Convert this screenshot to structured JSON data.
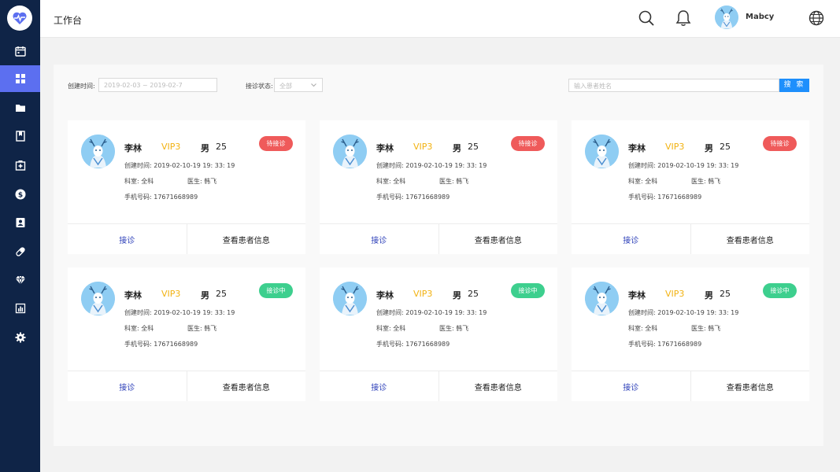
{
  "header": {
    "page_title": "工作台",
    "user_name": "Mabcy",
    "icons": [
      "search-icon",
      "bell-icon",
      "globe-icon"
    ]
  },
  "sidebar": {
    "logo_icon": "heartbeat-icon",
    "items": [
      {
        "icon": "calendar-icon"
      },
      {
        "icon": "dashboard-icon",
        "active": true
      },
      {
        "icon": "folder-icon"
      },
      {
        "icon": "bookmark-icon"
      },
      {
        "icon": "medical-box-icon"
      },
      {
        "icon": "dollar-icon"
      },
      {
        "icon": "contact-card-icon"
      },
      {
        "icon": "pill-icon"
      },
      {
        "icon": "diamond-icon"
      },
      {
        "icon": "bar-chart-icon"
      },
      {
        "icon": "settings-icon"
      }
    ]
  },
  "filters": {
    "created_label": "创建时间:",
    "created_value": "2019-02-03 ~ 2019-02-7",
    "status_label": "接诊状态:",
    "status_value": "全部",
    "search_placeholder": "输入患者姓名",
    "search_button": "搜 索"
  },
  "cards": [
    {
      "name": "李林",
      "vip": "VIP3",
      "gender": "男",
      "age": "25",
      "status": "待接诊",
      "status_type": "waiting",
      "created": "创建时间: 2019-02-10-19 19: 33: 19",
      "dept": "科室: 全科",
      "doctor": "医生: 韩飞",
      "phone": "手机号码: 17671668989",
      "action_receive": "接诊",
      "action_view": "查看患者信息"
    },
    {
      "name": "李林",
      "vip": "VIP3",
      "gender": "男",
      "age": "25",
      "status": "待接诊",
      "status_type": "waiting",
      "created": "创建时间: 2019-02-10-19 19: 33: 19",
      "dept": "科室: 全科",
      "doctor": "医生: 韩飞",
      "phone": "手机号码: 17671668989",
      "action_receive": "接诊",
      "action_view": "查看患者信息"
    },
    {
      "name": "李林",
      "vip": "VIP3",
      "gender": "男",
      "age": "25",
      "status": "待接诊",
      "status_type": "waiting",
      "created": "创建时间: 2019-02-10-19 19: 33: 19",
      "dept": "科室: 全科",
      "doctor": "医生: 韩飞",
      "phone": "手机号码: 17671668989",
      "action_receive": "接诊",
      "action_view": "查看患者信息"
    },
    {
      "name": "李林",
      "vip": "VIP3",
      "gender": "男",
      "age": "25",
      "status": "接诊中",
      "status_type": "active",
      "created": "创建时间: 2019-02-10-19 19: 33: 19",
      "dept": "科室: 全科",
      "doctor": "医生: 韩飞",
      "phone": "手机号码: 17671668989",
      "action_receive": "接诊",
      "action_view": "查看患者信息"
    },
    {
      "name": "李林",
      "vip": "VIP3",
      "gender": "男",
      "age": "25",
      "status": "接诊中",
      "status_type": "active",
      "created": "创建时间: 2019-02-10-19 19: 33: 19",
      "dept": "科室: 全科",
      "doctor": "医生: 韩飞",
      "phone": "手机号码: 17671668989",
      "action_receive": "接诊",
      "action_view": "查看患者信息"
    },
    {
      "name": "李林",
      "vip": "VIP3",
      "gender": "男",
      "age": "25",
      "status": "接诊中",
      "status_type": "active",
      "created": "创建时间: 2019-02-10-19 19: 33: 19",
      "dept": "科室: 全科",
      "doctor": "医生: 韩飞",
      "phone": "手机号码: 17671668989",
      "action_receive": "接诊",
      "action_view": "查看患者信息"
    }
  ],
  "colors": {
    "sidebar_bg": "#0f2447",
    "sidebar_active": "#5c6ff0",
    "vip": "#f2b211",
    "status_waiting": "#ef5a5a",
    "status_active": "#3dcf8e",
    "primary_button": "#1e8ffc",
    "action_link": "#2b3eb8"
  }
}
